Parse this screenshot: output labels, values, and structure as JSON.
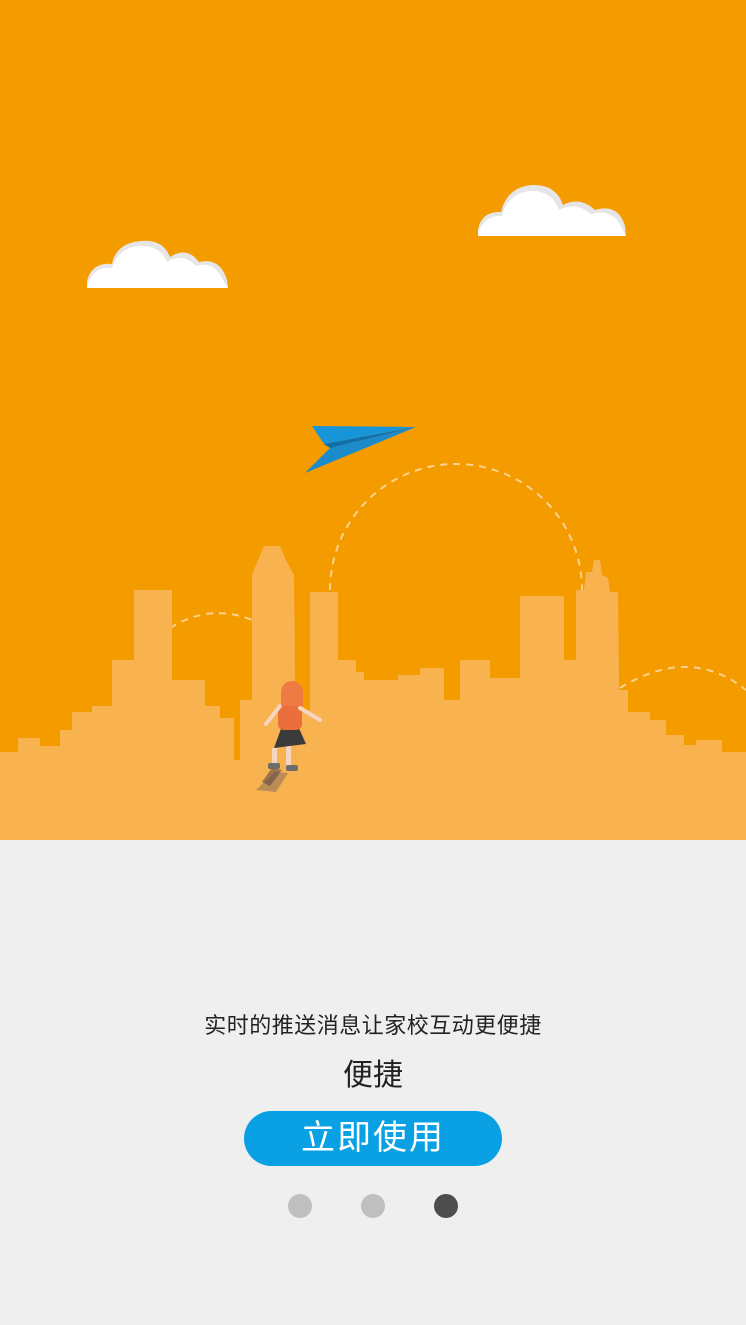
{
  "hero": {
    "background_color": "#f49b00",
    "skyline_color": "#f8b350",
    "illustration": [
      "cloud",
      "cloud",
      "paper-plane",
      "city-skyline",
      "running-girl"
    ]
  },
  "content": {
    "description": "实时的推送消息让家校互动更便捷",
    "title": "便捷"
  },
  "cta_button": {
    "label": "立即使用",
    "color": "#0aa0e4"
  },
  "pager": {
    "total": 3,
    "current": 3
  }
}
